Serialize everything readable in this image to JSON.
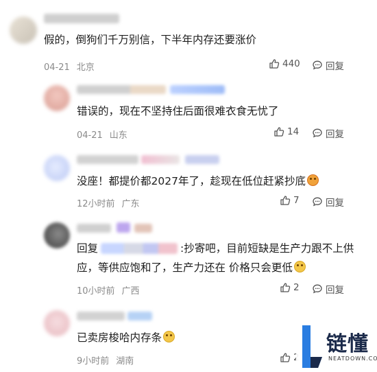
{
  "comments": [
    {
      "text": "假的，倒狗们千万别信，下半年内存还要涨价",
      "time": "04-21",
      "location": "北京",
      "likes": "440",
      "reply": "回复"
    },
    {
      "text": "错误的，现在不坚持住后面很难衣食无忧了",
      "time": "04-21",
      "location": "山东",
      "likes": "14",
      "reply": "回复"
    },
    {
      "text": "没座！都提价都2027年了，趁现在低位赶紧抄底",
      "time": "12小时前",
      "location": "广东",
      "likes": "7",
      "reply": "回复"
    },
    {
      "reply_prefix": "回复",
      "text_line1": ":抄寄吧，目前短缺是生产力跟不上供",
      "text_line2": "应，等供应饱和了，生产力还在 价格只会更低",
      "time": "10小时前",
      "location": "广西",
      "likes": "2",
      "reply": "回复"
    },
    {
      "text": "已卖房梭哈内存条",
      "time": "9小时前",
      "location": "湖南",
      "likes": "2"
    }
  ],
  "watermark": {
    "brand": "链懂",
    "domain": "NEATDOWN.COM"
  },
  "icons": {
    "like": "thumbs-up-icon",
    "reply": "comment-bubble-icon"
  },
  "colors": {
    "meta_text": "#8a8a8a",
    "accent_blue": "#2f6bff"
  }
}
